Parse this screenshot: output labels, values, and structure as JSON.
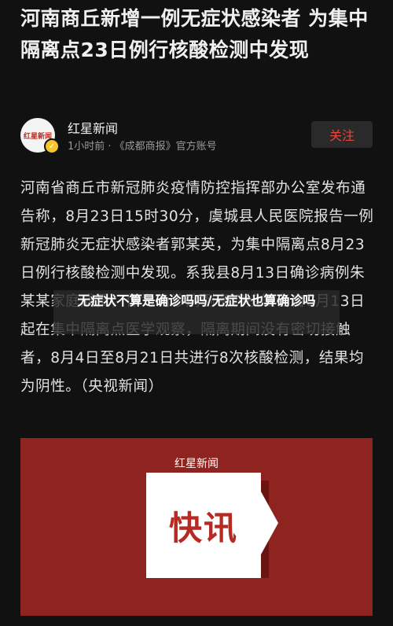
{
  "article": {
    "headline": "河南商丘新增一例无症状感染者 为集中隔离点23日例行核酸检测中发现"
  },
  "author": {
    "avatar_text": "红星新闻",
    "name": "红星新闻",
    "meta": "1小时前 · 《成都商报》官方账号",
    "follow_label": "关注"
  },
  "body": {
    "text": "河南省商丘市新冠肺炎疫情防控指挥部办公室发布通告称，8月23日15时30分，虞城县人民医院报告一例新冠肺炎无症状感染者郭某英，为集中隔离点8月23日例行核酸检测中发现。系我县8月13日确诊病例朱某某家庭成员，作为确诊病例密切接触者自8月13日起在集中隔离点医学观察，隔离期间没有密切接触者，8月4日至8月21日共进行8次核酸检测，结果均为阴性。（央视新闻）"
  },
  "overlay": {
    "title": "无症状不算是确诊吗吗/无症状也算确诊吗"
  },
  "image": {
    "brand": "红星新闻",
    "text": "快讯"
  }
}
